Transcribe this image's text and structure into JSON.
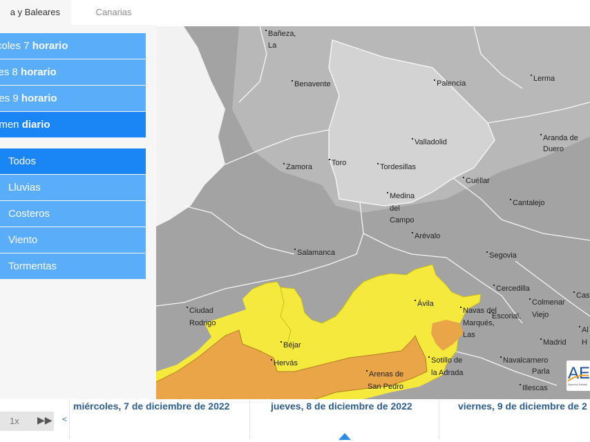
{
  "region_tabs": {
    "active": "a y Baleares",
    "inactive": "Canarias"
  },
  "day_menu": [
    {
      "prefix": "rcoles 7 ",
      "bold": "horario"
    },
    {
      "prefix": "ves 8 ",
      "bold": "horario"
    },
    {
      "prefix": "nes 9 ",
      "bold": "horario"
    },
    {
      "prefix": "umen ",
      "bold": "diario"
    }
  ],
  "layer_menu": [
    "Todos",
    "Lluvias",
    "Costeros",
    "Viento",
    "Tormentas"
  ],
  "colors": {
    "menu": "#5aadf9",
    "menu_selected": "#1a85f5",
    "alert_yellow": "#f4e93c",
    "alert_orange": "#e9a548",
    "map_grey": "#9e9e9e"
  },
  "map_cities": {
    "baneza": "Bañeza,",
    "la": "La",
    "benavente": "Benavente",
    "palencia": "Palencia",
    "lerma": "Lerma",
    "valladolid": "Valladolid",
    "aranda": "Aranda de",
    "duero": "Duero",
    "zamora": "Zamora",
    "toro": "Toro",
    "tordesillas": "Tordesillas",
    "cuellar": "Cuéllar",
    "medina": "Medina",
    "del": "del",
    "campo": "Campo",
    "arevalo": "Arévalo",
    "cantalejo": "Cantalejo",
    "salamanca": "Salamanca",
    "segovia": "Segovia",
    "cercedilla": "Cercedilla",
    "cas": "Cas",
    "colmenar": "Colmenar",
    "viejo": "Viejo",
    "avila": "Ávila",
    "navas": "Navas del",
    "escorial": "Escorial,",
    "marques": "Marqués,",
    "las": "Las",
    "al": "Al",
    "ciudad": "Ciudad",
    "rodrigo": "Rodrigo",
    "madrid": "Madrid",
    "h": "H",
    "bejar": "Béjar",
    "hervas": "Hervás",
    "sotillo": "Sotillo de",
    "adrada": "la Adrada",
    "navalcarnero": "Navalcarnero",
    "parla": "Parla",
    "arenas": "Arenas de",
    "sanpedro": "San Pedro",
    "illescas": "Illescas"
  },
  "logo": {
    "letters": "AE",
    "text": "Agencia Estatal"
  },
  "timeline": {
    "speed": "1x",
    "ff_icon": "▶▶",
    "prev": "<",
    "days": [
      "miércoles, 7 de diciembre de 2022",
      "jueves, 8 de diciembre de 2022",
      "viernes, 9 de diciembre de 2"
    ]
  }
}
